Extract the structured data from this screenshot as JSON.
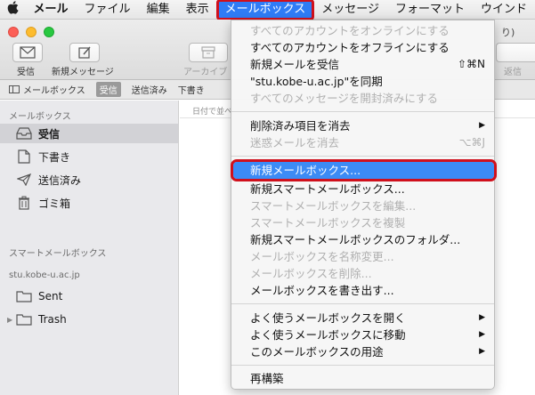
{
  "menubar": {
    "items": [
      {
        "label": "メール"
      },
      {
        "label": "ファイル"
      },
      {
        "label": "編集"
      },
      {
        "label": "表示"
      },
      {
        "label": "メールボックス"
      },
      {
        "label": "メッセージ"
      },
      {
        "label": "フォーマット"
      },
      {
        "label": "ウインド"
      }
    ]
  },
  "toolbar": {
    "inbox_label": "受信",
    "new_message_label": "新規メッセージ",
    "archive_label": "アーカイブ",
    "reply_label": "返信",
    "title_partial": "り)"
  },
  "favorites": {
    "mailboxes_label": "メールボックス",
    "inbox": "受信",
    "sent": "送信済み",
    "drafts": "下書き"
  },
  "sidebar": {
    "mailboxes_header": "メールボックス",
    "items": [
      {
        "label": "受信",
        "icon": "inbox-tray-icon"
      },
      {
        "label": "下書き",
        "icon": "document-icon"
      },
      {
        "label": "送信済み",
        "icon": "paper-plane-icon"
      },
      {
        "label": "ゴミ箱",
        "icon": "trash-icon"
      }
    ],
    "smart_header": "スマートメールボックス",
    "account_header": "stu.kobe-u.ac.jp",
    "account_items": [
      {
        "label": "Sent",
        "icon": "folder-icon"
      },
      {
        "label": "Trash",
        "icon": "folder-icon"
      }
    ]
  },
  "content": {
    "sort_label": "日付で並べ"
  },
  "dropdown": {
    "items": [
      {
        "label": "すべてのアカウントをオンラインにする",
        "disabled": true
      },
      {
        "label": "すべてのアカウントをオフラインにする",
        "disabled": false
      },
      {
        "label": "新規メールを受信",
        "shortcut": "⇧⌘N",
        "disabled": false
      },
      {
        "label": "\"stu.kobe-u.ac.jp\"を同期",
        "disabled": false
      },
      {
        "label": "すべてのメッセージを開封済みにする",
        "disabled": true
      },
      {
        "label": "削除済み項目を消去",
        "submenu": true,
        "disabled": false
      },
      {
        "label": "迷惑メールを消去",
        "shortcut": "⌥⌘J",
        "disabled": true
      },
      {
        "label": "新規メールボックス...",
        "highlighted": true
      },
      {
        "label": "新規スマートメールボックス...",
        "disabled": false
      },
      {
        "label": "スマートメールボックスを編集...",
        "disabled": true
      },
      {
        "label": "スマートメールボックスを複製",
        "disabled": true
      },
      {
        "label": "新規スマートメールボックスのフォルダ...",
        "disabled": false
      },
      {
        "label": "メールボックスを名称変更...",
        "disabled": true
      },
      {
        "label": "メールボックスを削除...",
        "disabled": true
      },
      {
        "label": "メールボックスを書き出す...",
        "disabled": false
      },
      {
        "label": "よく使うメールボックスを開く",
        "submenu": true,
        "disabled": false
      },
      {
        "label": "よく使うメールボックスに移動",
        "submenu": true,
        "disabled": false
      },
      {
        "label": "このメールボックスの用途",
        "submenu": true,
        "disabled": false
      },
      {
        "label": "再構築",
        "disabled": false
      }
    ]
  },
  "colors": {
    "highlight": "#3c8bf5",
    "annotation_red": "#d0101c"
  }
}
